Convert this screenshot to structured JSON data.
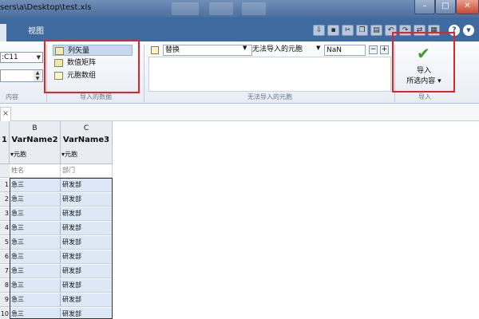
{
  "window": {
    "title": "sers\\a\\Desktop\\test.xls"
  },
  "tabs": {
    "view_label": "视图"
  },
  "ribbon": {
    "range_value": ":C11",
    "range_group_label": "内容",
    "output_type_group_label": "导入的数据",
    "output_types": [
      {
        "label": "列矢量",
        "selected": true
      },
      {
        "label": "数值矩阵",
        "selected": false
      },
      {
        "label": "元胞数组",
        "selected": false
      }
    ],
    "unimportable_group_label": "无法导入的元胞",
    "rule": {
      "action": "替换",
      "condition": "无法导入的元胞",
      "value": "NaN",
      "minus": "−",
      "plus": "+"
    },
    "import_group_label": "导入",
    "import_button": {
      "line1": "导入",
      "line2": "所选内容"
    }
  },
  "sheet": {
    "tab_close": "×",
    "columns": [
      {
        "letter": "B",
        "var_name": "VarName2",
        "type": "▾元胞",
        "header_text": "姓名"
      },
      {
        "letter": "C",
        "var_name": "VarName3",
        "type": "▾元胞",
        "header_text": "部门"
      }
    ],
    "first_column_stub": "1",
    "rows": [
      {
        "num": "1",
        "b": "急三",
        "c": "研发部"
      },
      {
        "num": "2",
        "b": "急三",
        "c": "研发部"
      },
      {
        "num": "3",
        "b": "急三",
        "c": "研发部"
      },
      {
        "num": "4",
        "b": "急三",
        "c": "研发部"
      },
      {
        "num": "5",
        "b": "急三",
        "c": "研发部"
      },
      {
        "num": "6",
        "b": "急三",
        "c": "研发部"
      },
      {
        "num": "7",
        "b": "急三",
        "c": "研发部"
      },
      {
        "num": "8",
        "b": "急三",
        "c": "研发部"
      },
      {
        "num": "9",
        "b": "急三",
        "c": "研发部"
      },
      {
        "num": "10",
        "b": "急三",
        "c": "研发部"
      }
    ]
  },
  "colors": {
    "accent_highlight": "#e0242a",
    "selected_cell_fill": "#dce8f5",
    "ribbon_blue": "#3f6aa0"
  }
}
